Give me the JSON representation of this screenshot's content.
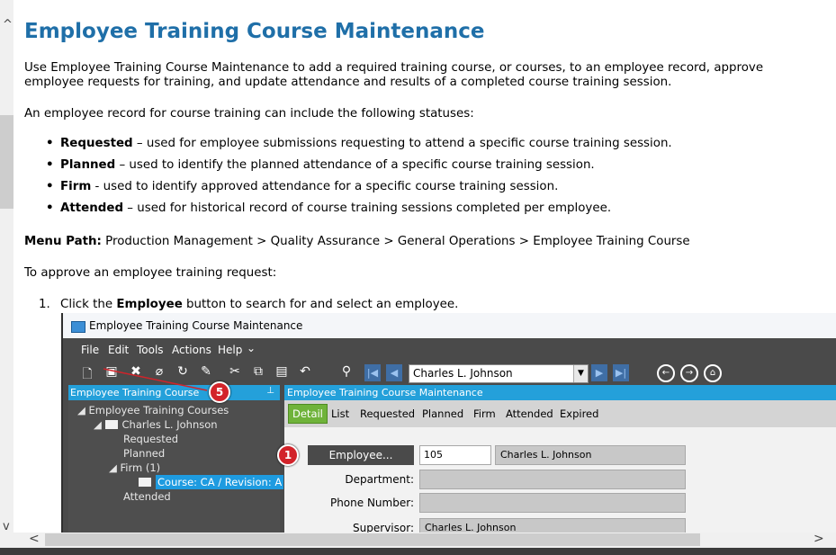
{
  "doc": {
    "title": "Employee Training Course Maintenance",
    "intro": "Use Employee Training Course Maintenance to add a required training course, or courses, to an employee record, approve employee requests for training, and update attendance and results of a completed course training session.",
    "statuses_intro": "An employee record for course training can include the following statuses:",
    "statuses": [
      {
        "term": "Requested",
        "desc": " – used for employee submissions requesting to attend a specific course training session."
      },
      {
        "term": "Planned",
        "desc": " – used to identify the planned attendance of a specific course training session."
      },
      {
        "term": "Firm",
        "desc": " - used to identify approved attendance for a specific course training session."
      },
      {
        "term": "Attended",
        "desc": " – used for historical record of course training sessions completed per employee."
      }
    ],
    "menu_path_label": "Menu Path:",
    "menu_path": " Production Management > Quality Assurance > General Operations > Employee Training Course",
    "approve_intro": "To approve an employee training request:",
    "step1": {
      "num": "1.",
      "pre": "Click the ",
      "bold": "Employee",
      "post": " button to search for and select an employee."
    }
  },
  "app": {
    "window_title": "Employee Training Course Maintenance",
    "menu": [
      "File",
      "Edit",
      "Tools",
      "Actions",
      "Help"
    ],
    "menu_more": "⌄",
    "employee_select": "Charles L. Johnson",
    "tree_header": "Employee Training Course",
    "tree": {
      "root": "Employee Training Courses",
      "employee": "Charles L. Johnson",
      "requested": "Requested",
      "planned": "Planned",
      "firm": "Firm (1)",
      "course": "Course: CA / Revision: A",
      "attended": "Attended"
    },
    "form_header": "Employee Training Course Maintenance",
    "tabs": [
      "Detail",
      "List",
      "Requested",
      "Planned",
      "Firm",
      "Attended",
      "Expired"
    ],
    "employee_button": "Employee...",
    "employee_id": "105",
    "employee_name": "Charles L. Johnson",
    "labels": {
      "department": "Department:",
      "phone": "Phone Number:",
      "supervisor": "Supervisor:"
    },
    "supervisor_value": "Charles L. Johnson",
    "callouts": [
      "5",
      "1"
    ]
  },
  "icons": [
    "scroll-up-icon",
    "scroll-down-icon",
    "scroll-left-icon",
    "scroll-right-icon",
    "window-icon",
    "new-icon",
    "save-icon",
    "delete-icon",
    "attach-icon",
    "refresh-icon",
    "clear-icon",
    "cut-icon",
    "copy-icon",
    "paste-icon",
    "undo-icon",
    "binoculars-icon",
    "first-icon",
    "prev-icon",
    "next-icon",
    "last-icon",
    "back-icon",
    "forward-icon",
    "home-icon",
    "pin-icon",
    "folder-icon"
  ],
  "colors": {
    "heading": "#1f6fa8",
    "panel_header": "#24a0da",
    "tab_active": "#6fb33a",
    "callout": "#d2232a",
    "app_dark": "#4a4a4a"
  }
}
